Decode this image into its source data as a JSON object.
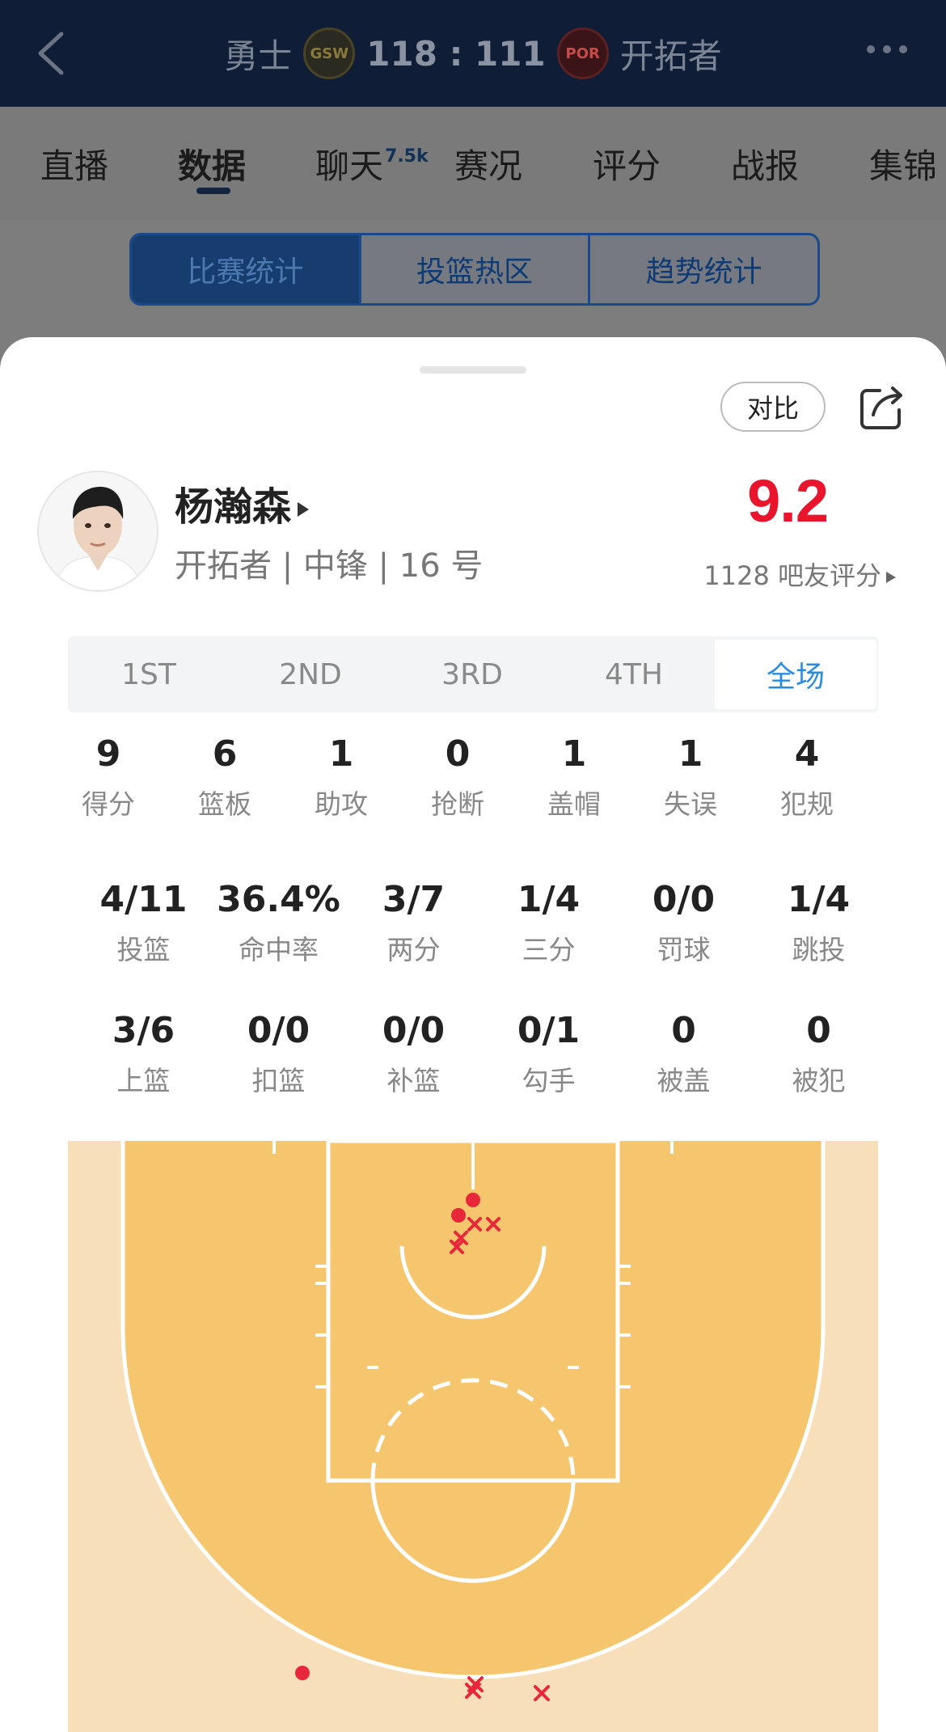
{
  "header": {
    "home_team": "勇士",
    "home_logo": "GSW",
    "score": "118 : 111",
    "away_logo": "POR",
    "away_team": "开拓者"
  },
  "tabs": [
    {
      "label": "直播"
    },
    {
      "label": "数据",
      "active": true
    },
    {
      "label": "聊天",
      "badge": "7.5k"
    },
    {
      "label": "赛况"
    },
    {
      "label": "评分"
    },
    {
      "label": "战报"
    },
    {
      "label": "集锦"
    }
  ],
  "segments": [
    {
      "label": "比赛统计",
      "active": true
    },
    {
      "label": "投篮热区"
    },
    {
      "label": "趋势统计"
    }
  ],
  "sheet": {
    "compare_label": "对比"
  },
  "player": {
    "name": "杨瀚森",
    "meta": "开拓者 | 中锋 | 16 号",
    "rating": "9.2",
    "rating_count": "1128 吧友评分"
  },
  "periods": [
    {
      "label": "1ST"
    },
    {
      "label": "2ND"
    },
    {
      "label": "3RD"
    },
    {
      "label": "4TH"
    },
    {
      "label": "全场",
      "active": true
    }
  ],
  "stats_basic": [
    {
      "value": "9",
      "label": "得分"
    },
    {
      "value": "6",
      "label": "篮板"
    },
    {
      "value": "1",
      "label": "助攻"
    },
    {
      "value": "0",
      "label": "抢断"
    },
    {
      "value": "1",
      "label": "盖帽"
    },
    {
      "value": "1",
      "label": "失误"
    },
    {
      "value": "4",
      "label": "犯规"
    }
  ],
  "stats_shooting": [
    {
      "value": "4/11",
      "label": "投篮"
    },
    {
      "value": "36.4%",
      "label": "命中率"
    },
    {
      "value": "3/7",
      "label": "两分"
    },
    {
      "value": "1/4",
      "label": "三分"
    },
    {
      "value": "0/0",
      "label": "罚球"
    },
    {
      "value": "1/4",
      "label": "跳投"
    }
  ],
  "stats_detail": [
    {
      "value": "3/6",
      "label": "上篮"
    },
    {
      "value": "0/0",
      "label": "扣篮"
    },
    {
      "value": "0/0",
      "label": "补篮"
    },
    {
      "value": "0/1",
      "label": "勾手"
    },
    {
      "value": "0",
      "label": "被盖"
    },
    {
      "value": "0",
      "label": "被犯"
    }
  ],
  "shot_chart": {
    "made": 4,
    "missed": 7,
    "colors": {
      "made": "#e8283a",
      "missed": "#e8283a",
      "court_inner": "#f6c66e",
      "court_outer": "#f7dfb9"
    }
  }
}
